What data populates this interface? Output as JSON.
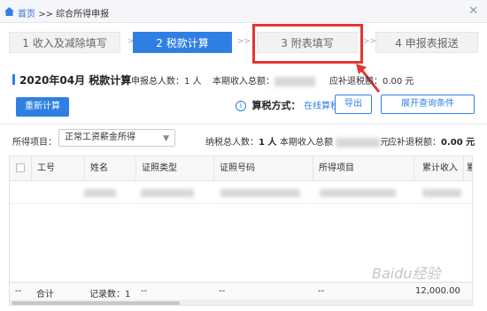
{
  "breadcrumb": {
    "home": "首页",
    "separator": ">>",
    "current": "综合所得申报"
  },
  "steps": [
    {
      "label": "1 收入及减除填写"
    },
    {
      "label": "2 税款计算"
    },
    {
      "label": "3 附表填写"
    },
    {
      "label": "4 申报表报送"
    }
  ],
  "step_arrow": ">>",
  "summary": {
    "period": "2020年04月",
    "section_title": "税款计算",
    "declare_count_label": "申报总人数：",
    "declare_count_value": "1 人",
    "income_label": "本期收入总额：",
    "refund_label": "应补退税额：",
    "refund_value": "0.00 元"
  },
  "actions": {
    "recalc": "重新计算",
    "calc_method_label": "算税方式：",
    "calc_method_value": "在线算税",
    "export": "导出",
    "expand_query": "展开查询条件"
  },
  "filter": {
    "label": "所得项目：",
    "selected": "正常工资薪金所得",
    "taxpayer_label": "纳税总人数：",
    "taxpayer_value": "1 人",
    "income_label": "本期收入总额",
    "income_unit": "元",
    "refund_label": "应补退税额：",
    "refund_value": "0.00 元"
  },
  "table": {
    "columns": [
      "工号",
      "姓名",
      "证照类型",
      "证照号码",
      "所得项目",
      "累计收入",
      "累"
    ],
    "footer": {
      "dash": "--",
      "total_label": "合计",
      "record_count": "记录数：1",
      "total_income": "12,000.00"
    }
  },
  "watermark": "Baidu经验"
}
